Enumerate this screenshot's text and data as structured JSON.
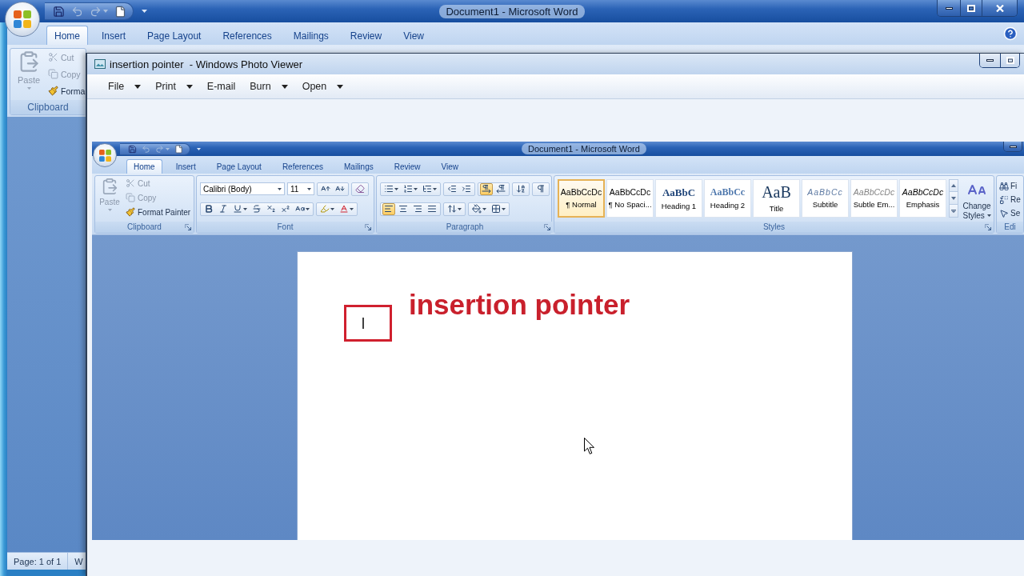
{
  "word_window": {
    "title": "Document1 - Microsoft Word",
    "quick_access_toolbar": [
      {
        "kind": "save",
        "disabled": false
      },
      {
        "kind": "undo",
        "disabled": true
      },
      {
        "kind": "redo",
        "disabled": true
      },
      {
        "kind": "new",
        "disabled": false
      }
    ],
    "tabs": [
      {
        "label": "Home",
        "selected": true
      },
      {
        "label": "Insert",
        "selected": false
      },
      {
        "label": "Page Layout",
        "selected": false
      },
      {
        "label": "References",
        "selected": false
      },
      {
        "label": "Mailings",
        "selected": false
      },
      {
        "label": "Review",
        "selected": false
      },
      {
        "label": "View",
        "selected": false
      }
    ],
    "clipboard_group": {
      "label": "Clipboard",
      "commands": [
        {
          "kind": "paste",
          "label": "Paste",
          "disabled": true
        },
        {
          "kind": "cut",
          "label": "Cut",
          "disabled": true
        },
        {
          "kind": "copy",
          "label": "Copy",
          "disabled": true
        },
        {
          "kind": "format_painter",
          "label": "Forma",
          "disabled": false
        }
      ]
    },
    "status_bar": [
      "Page: 1 of 1",
      "W"
    ]
  },
  "photo_viewer": {
    "title": "insertion pointer  - Windows Photo Viewer",
    "menu": [
      {
        "label": "File",
        "has_dropdown": true
      },
      {
        "label": "Print",
        "has_dropdown": true
      },
      {
        "label": "E-mail",
        "has_dropdown": false
      },
      {
        "label": "Burn",
        "has_dropdown": true
      },
      {
        "label": "Open",
        "has_dropdown": true
      }
    ],
    "image": {
      "title": "Document1 - Microsoft Word",
      "quick_access_toolbar": [
        {
          "kind": "save",
          "disabled": false
        },
        {
          "kind": "undo",
          "disabled": true
        },
        {
          "kind": "redo",
          "disabled": true
        },
        {
          "kind": "new",
          "disabled": false
        }
      ],
      "tabs": [
        {
          "label": "Home",
          "selected": true
        },
        {
          "label": "Insert",
          "selected": false
        },
        {
          "label": "Page Layout",
          "selected": false
        },
        {
          "label": "References",
          "selected": false
        },
        {
          "label": "Mailings",
          "selected": false
        },
        {
          "label": "Review",
          "selected": false
        },
        {
          "label": "View",
          "selected": false
        }
      ],
      "clipboard_group": {
        "label": "Clipboard",
        "commands": [
          {
            "kind": "paste",
            "label": "Paste",
            "disabled": true
          },
          {
            "kind": "cut",
            "label": "Cut",
            "disabled": true
          },
          {
            "kind": "copy",
            "label": "Copy",
            "disabled": true
          },
          {
            "kind": "format_painter",
            "label": "Format Painter",
            "disabled": false
          }
        ]
      },
      "font_group": {
        "label": "Font",
        "font_name": "Calibri (Body)",
        "font_size": "11"
      },
      "paragraph_group": {
        "label": "Paragraph",
        "text_direction": [
          {
            "kind": "left_to_right",
            "selected": true
          },
          {
            "kind": "right_to_left",
            "selected": false
          }
        ],
        "alignment": [
          {
            "kind": "left",
            "selected": true
          },
          {
            "kind": "center",
            "selected": false
          },
          {
            "kind": "right",
            "selected": false
          },
          {
            "kind": "justify",
            "selected": false
          }
        ]
      },
      "styles_group": {
        "label": "Styles",
        "styles": [
          {
            "kind": "normal",
            "preview": "AaBbCcDc",
            "name": "¶ Normal",
            "selected": true
          },
          {
            "kind": "normal",
            "preview": "AaBbCcDc",
            "name": "¶ No Spaci...",
            "selected": false
          },
          {
            "kind": "heading1",
            "preview": "AaBbC",
            "name": "Heading 1",
            "selected": false
          },
          {
            "kind": "heading2",
            "preview": "AaBbCc",
            "name": "Heading 2",
            "selected": false
          },
          {
            "kind": "title",
            "preview": "AaB",
            "name": "Title",
            "selected": false
          },
          {
            "kind": "subtitle",
            "preview": "AaBbCc",
            "name": "Subtitle",
            "selected": false
          },
          {
            "kind": "subtle",
            "preview": "AaBbCcDc",
            "name": "Subtle Em...",
            "selected": false
          },
          {
            "kind": "emphasis",
            "preview": "AaBbCcDc",
            "name": "Emphasis",
            "selected": false
          }
        ],
        "change_styles": "Change Styles"
      },
      "editing_group": {
        "label": "Edi",
        "commands": [
          {
            "kind": "find",
            "label": "Fi"
          },
          {
            "kind": "replace",
            "label": "Re"
          },
          {
            "kind": "select",
            "label": "Se"
          }
        ]
      },
      "document": {
        "heading": "insertion pointer"
      }
    }
  }
}
